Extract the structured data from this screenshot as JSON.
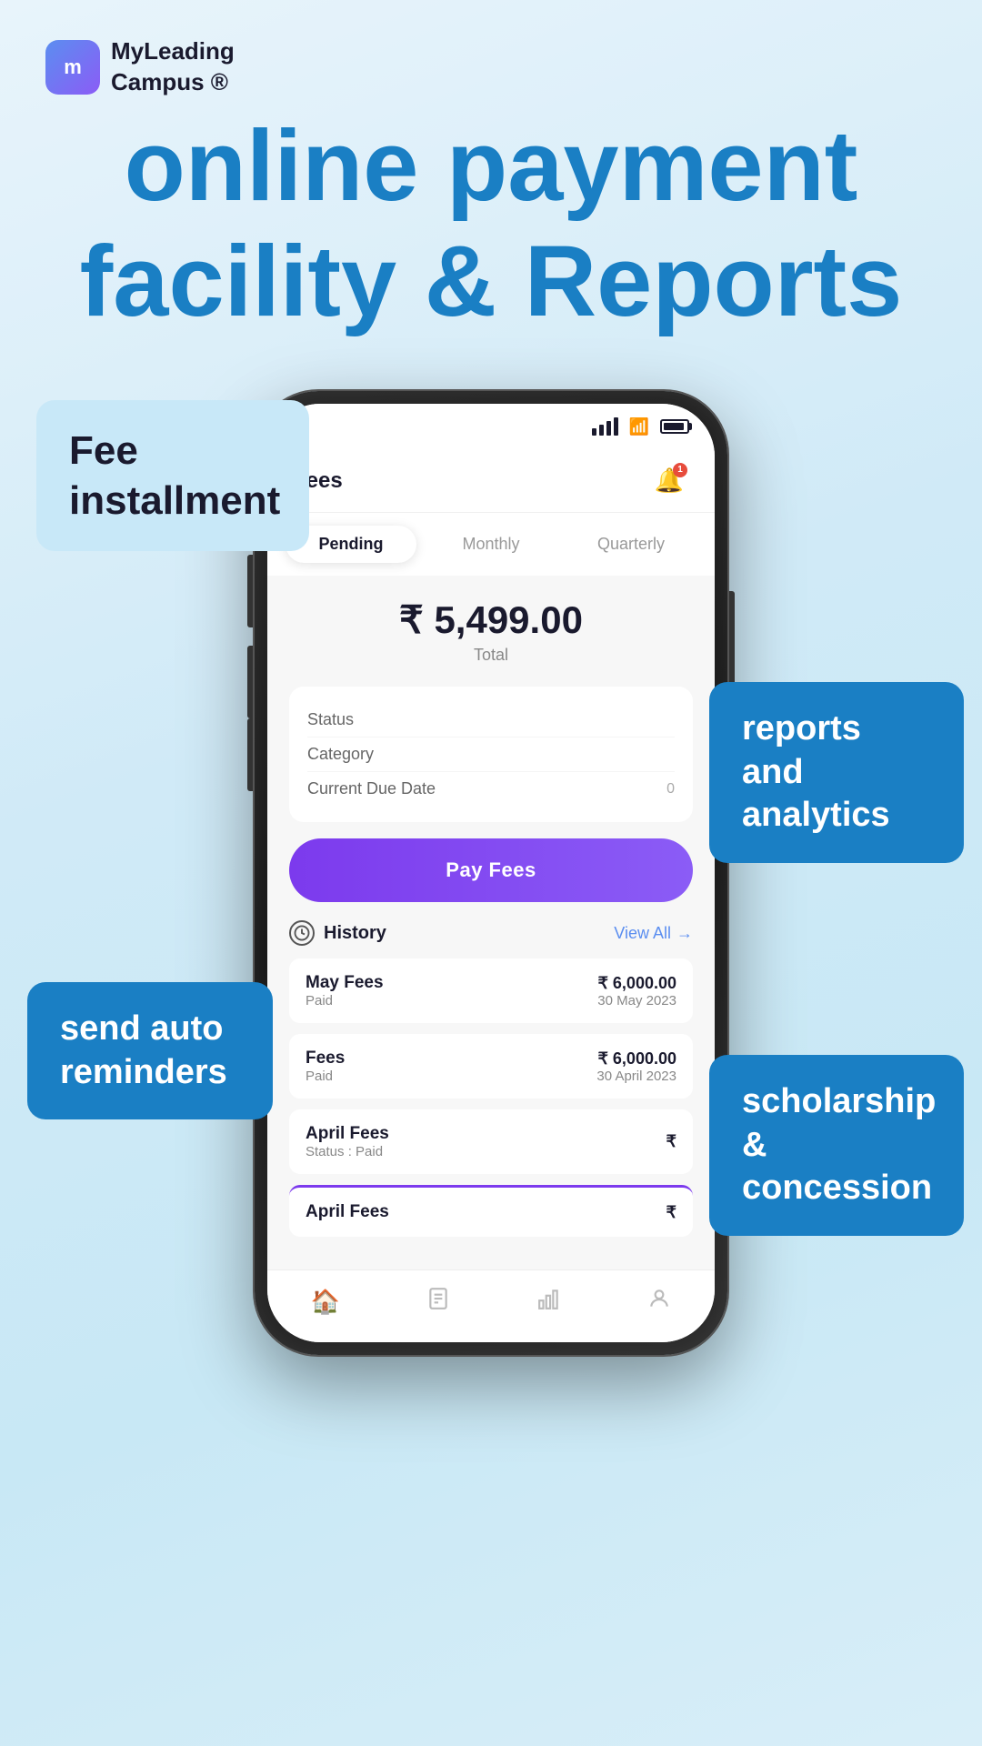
{
  "logo": {
    "icon_text": "m",
    "name_line1": "MyLeading",
    "name_line2": "Campus ®"
  },
  "heading": {
    "line1": "online payment",
    "line2": "facility & Reports"
  },
  "status_bar": {
    "signal_alt": "signal",
    "wifi_alt": "wifi",
    "battery_alt": "battery",
    "notif_count": "1"
  },
  "app_header": {
    "title": "Fees",
    "notif_badge": "1"
  },
  "tabs": [
    {
      "label": "Pending",
      "active": true
    },
    {
      "label": "Monthly",
      "active": false
    },
    {
      "label": "Quarterly",
      "active": false
    }
  ],
  "total": {
    "amount": "₹ 5,499.00",
    "label": "Total"
  },
  "info_rows": [
    {
      "label": "Status",
      "value": ""
    },
    {
      "label": "Category",
      "value": ""
    },
    {
      "label": "Current Due Date",
      "value": "0"
    }
  ],
  "pay_button": {
    "label": "Pay Fees"
  },
  "history": {
    "title": "History",
    "view_all": "View All",
    "arrow": "→",
    "items": [
      {
        "name": "May Fees",
        "status": "Paid",
        "amount": "₹ 6,000.00",
        "date": "30 May 2023"
      },
      {
        "name": "Fees",
        "status": "Paid",
        "amount": "₹ 6,000.00",
        "date": "30 April 2023"
      },
      {
        "name": "April Fees",
        "status": "Status : Paid",
        "amount": "₹",
        "date": ""
      },
      {
        "name": "April Fees",
        "status": "",
        "amount": "₹",
        "date": ""
      }
    ]
  },
  "bottom_nav": [
    {
      "icon": "🏠",
      "active": true,
      "label": "home"
    },
    {
      "icon": "📄",
      "active": false,
      "label": "docs"
    },
    {
      "icon": "📊",
      "active": false,
      "label": "analytics"
    },
    {
      "icon": "👤",
      "active": false,
      "label": "profile"
    }
  ],
  "floating_labels": {
    "fee_installment": {
      "line1": "Fee",
      "line2": "installment"
    },
    "reports_analytics": {
      "line1": "reports and",
      "line2": "analytics"
    },
    "send_reminders": {
      "line1": "send auto",
      "line2": "reminders"
    },
    "scholarship": {
      "line1": "scholarship &",
      "line2": "concession"
    }
  }
}
